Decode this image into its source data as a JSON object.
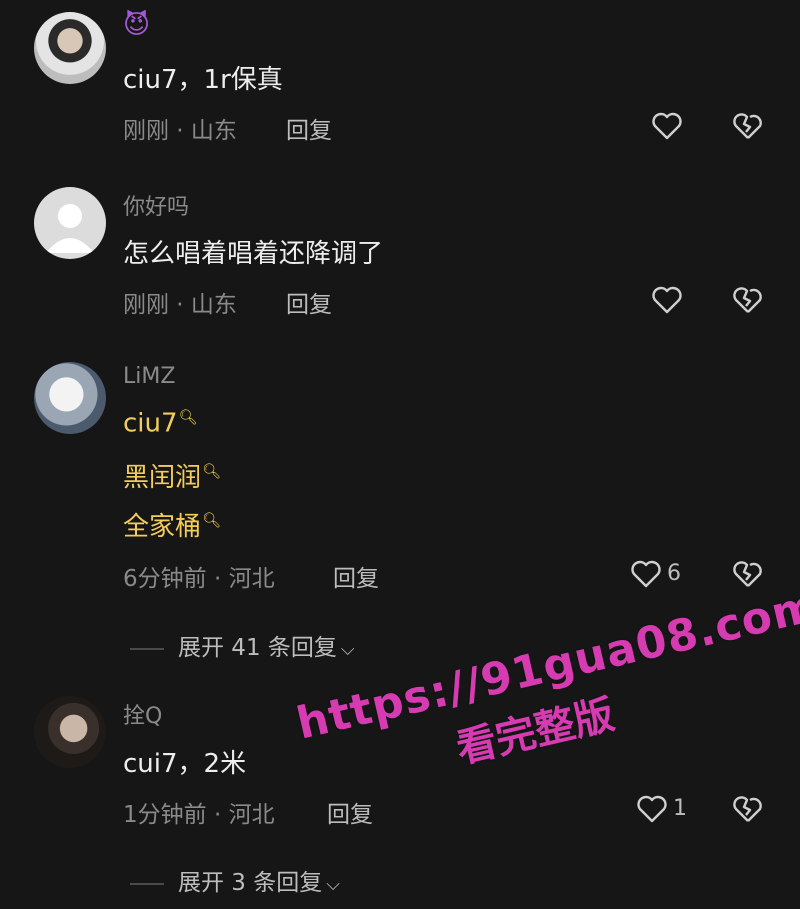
{
  "comments": [
    {
      "username": "",
      "emoji": "😈",
      "text": "ciu7，1r保真",
      "meta": "刚刚 · 山东",
      "reply_label": "回复",
      "likes": ""
    },
    {
      "username": "你好吗",
      "text": "怎么唱着唱着还降调了",
      "meta": "刚刚 · 山东",
      "reply_label": "回复",
      "likes": ""
    },
    {
      "username": "LiMZ",
      "tags": [
        "ciu7",
        "黑闰润",
        "全家桶"
      ],
      "meta": "6分钟前 · 河北",
      "reply_label": "回复",
      "likes": "6",
      "expand_label": "展开 41 条回复"
    },
    {
      "username": "拴Q",
      "text": "cui7，2米",
      "meta": "1分钟前 · 河北",
      "reply_label": "回复",
      "likes": "1",
      "expand_label": "展开 3 条回复"
    }
  ],
  "watermark": {
    "line1": "https://91gua08.com",
    "line2": "看完整版"
  },
  "colors": {
    "background": "#161616",
    "tag_highlight": "#f3cc5a",
    "watermark": "#d63bb1"
  }
}
